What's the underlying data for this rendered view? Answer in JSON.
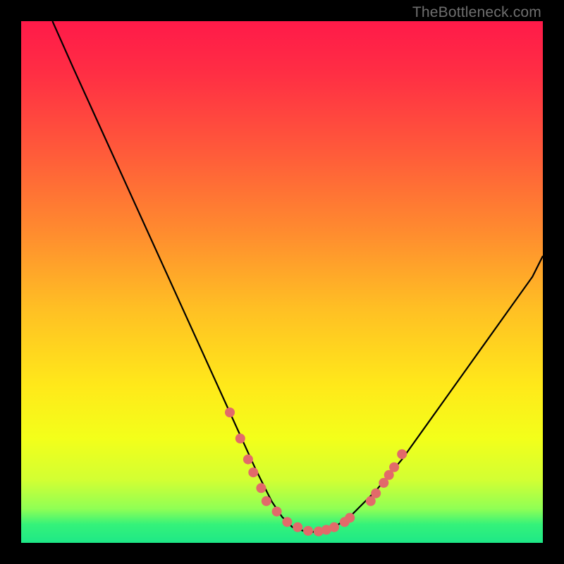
{
  "watermark": "TheBottleneck.com",
  "gradient": {
    "stops": [
      {
        "offset": 0.0,
        "color": "#ff1a49"
      },
      {
        "offset": 0.1,
        "color": "#ff2e44"
      },
      {
        "offset": 0.25,
        "color": "#ff5a3a"
      },
      {
        "offset": 0.4,
        "color": "#ff8a2f"
      },
      {
        "offset": 0.55,
        "color": "#ffbf24"
      },
      {
        "offset": 0.7,
        "color": "#ffe91a"
      },
      {
        "offset": 0.8,
        "color": "#f3ff1a"
      },
      {
        "offset": 0.88,
        "color": "#d2ff33"
      },
      {
        "offset": 0.935,
        "color": "#8fff55"
      },
      {
        "offset": 0.965,
        "color": "#34f27a"
      },
      {
        "offset": 1.0,
        "color": "#1ee887"
      }
    ]
  },
  "chart_data": {
    "type": "line",
    "title": "",
    "xlabel": "",
    "ylabel": "",
    "xlim": [
      0,
      100
    ],
    "ylim": [
      0,
      100
    ],
    "series": [
      {
        "name": "curve",
        "x": [
          6,
          10,
          15,
          20,
          25,
          30,
          35,
          40,
          45,
          48,
          50,
          52,
          55,
          58,
          60,
          63,
          68,
          73,
          78,
          83,
          88,
          93,
          98,
          100
        ],
        "y": [
          100,
          91,
          80,
          69,
          58,
          47,
          36,
          25,
          14,
          8,
          5,
          3,
          2,
          2.3,
          3,
          5,
          10,
          16,
          23,
          30,
          37,
          44,
          51,
          55
        ]
      }
    ],
    "markers": [
      {
        "x": 40,
        "y": 25
      },
      {
        "x": 42,
        "y": 20
      },
      {
        "x": 43.5,
        "y": 16
      },
      {
        "x": 44.5,
        "y": 13.5
      },
      {
        "x": 46,
        "y": 10.5
      },
      {
        "x": 47,
        "y": 8
      },
      {
        "x": 49,
        "y": 6
      },
      {
        "x": 51,
        "y": 4
      },
      {
        "x": 53,
        "y": 3
      },
      {
        "x": 55,
        "y": 2.3
      },
      {
        "x": 57,
        "y": 2.2
      },
      {
        "x": 58.5,
        "y": 2.5
      },
      {
        "x": 60,
        "y": 3
      },
      {
        "x": 62,
        "y": 4
      },
      {
        "x": 63,
        "y": 4.8
      },
      {
        "x": 67,
        "y": 8
      },
      {
        "x": 68,
        "y": 9.5
      },
      {
        "x": 69.5,
        "y": 11.5
      },
      {
        "x": 70.5,
        "y": 13
      },
      {
        "x": 71.5,
        "y": 14.5
      },
      {
        "x": 73,
        "y": 17
      }
    ],
    "marker_style": {
      "color": "#e26a6a",
      "radius_px": 7
    }
  }
}
